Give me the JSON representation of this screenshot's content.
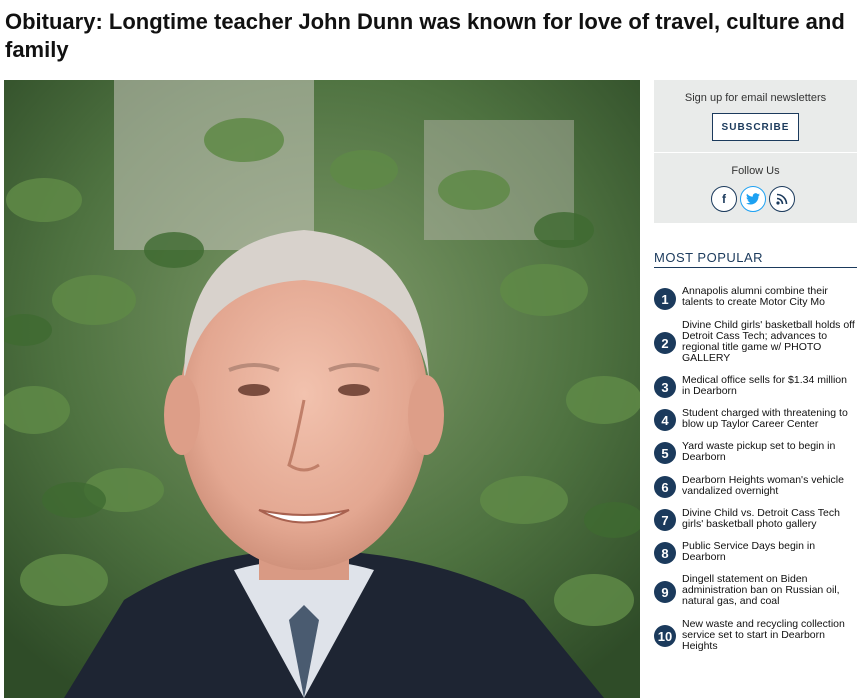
{
  "article": {
    "headline": "Obituary: Longtime teacher John Dunn was known for love of travel, culture and family"
  },
  "sidebar": {
    "newsletter_label": "Sign up for email newsletters",
    "subscribe_label": "SUBSCRIBE",
    "follow_label": "Follow Us",
    "social": [
      {
        "icon": "facebook-icon",
        "glyph": "f"
      },
      {
        "icon": "twitter-icon",
        "glyph": "🐦"
      },
      {
        "icon": "rss-icon",
        "glyph": "⟆"
      }
    ]
  },
  "most_popular": {
    "title": "MOST POPULAR",
    "items": [
      {
        "num": "1",
        "text": "Annapolis alumni combine their talents to create Motor City Mo"
      },
      {
        "num": "2",
        "text": "Divine Child girls' basketball holds off Detroit Cass Tech; advances to regional title game w/ PHOTO GALLERY"
      },
      {
        "num": "3",
        "text": "Medical office sells for $1.34 million in Dearborn"
      },
      {
        "num": "4",
        "text": "Student charged with threatening to blow up Taylor Career Center"
      },
      {
        "num": "5",
        "text": "Yard waste pickup set to begin in Dearborn"
      },
      {
        "num": "6",
        "text": "Dearborn Heights woman's vehicle vandalized overnight"
      },
      {
        "num": "7",
        "text": "Divine Child vs. Detroit Cass Tech girls' basketball photo gallery"
      },
      {
        "num": "8",
        "text": "Public Service Days begin in Dearborn"
      },
      {
        "num": "9",
        "text": "Dingell statement on Biden administration ban on Russian oil, natural gas, and coal"
      },
      {
        "num": "10",
        "text": "New waste and recycling collection service set to start in Dearborn Heights"
      }
    ]
  },
  "colors": {
    "accent": "#1b3a5c",
    "sidebar_bg": "#e9ebea"
  }
}
